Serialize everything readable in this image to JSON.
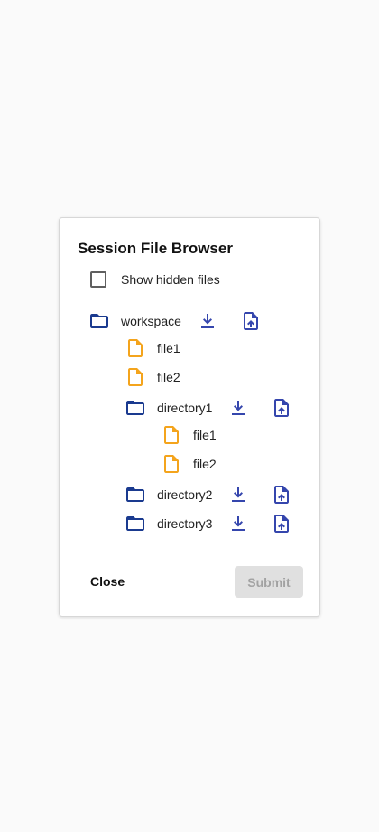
{
  "dialog": {
    "title": "Session File Browser",
    "show_hidden_label": "Show hidden files",
    "show_hidden_checked": false,
    "close_label": "Close",
    "submit_label": "Submit",
    "submit_disabled": true
  },
  "tree": [
    {
      "type": "folder",
      "name": "workspace",
      "depth": 0
    },
    {
      "type": "file",
      "name": "file1",
      "depth": 1
    },
    {
      "type": "file",
      "name": "file2",
      "depth": 1
    },
    {
      "type": "folder",
      "name": "directory1",
      "depth": 1
    },
    {
      "type": "file",
      "name": "file1",
      "depth": 2
    },
    {
      "type": "file",
      "name": "file2",
      "depth": 2
    },
    {
      "type": "folder",
      "name": "directory2",
      "depth": 1
    },
    {
      "type": "folder",
      "name": "directory3",
      "depth": 1
    }
  ],
  "icons": {
    "folder": "folder-outline-icon",
    "file": "file-outline-icon",
    "download": "download-icon",
    "upload": "file-upload-icon"
  },
  "colors": {
    "folder_icon": "#1a3a8f",
    "file_icon": "#f4a41c",
    "action_icon": "#3546ad",
    "submit_disabled_bg": "#e0e0e0",
    "submit_disabled_text": "#a2a2a2"
  }
}
